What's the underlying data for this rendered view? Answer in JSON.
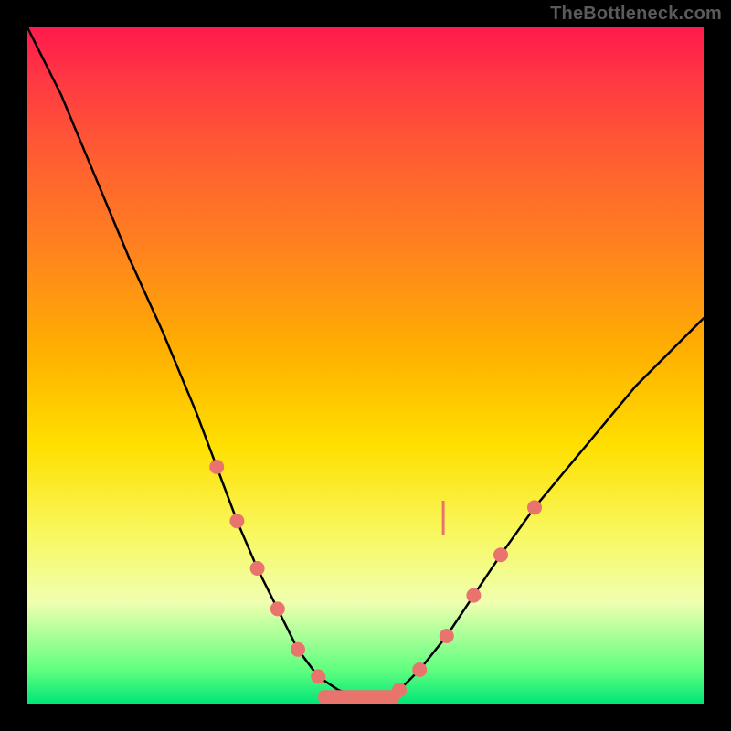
{
  "watermark": "TheBottleneck.com",
  "chart_data": {
    "type": "line",
    "title": "",
    "xlabel": "",
    "ylabel": "",
    "xlim": [
      0,
      100
    ],
    "ylim": [
      0,
      100
    ],
    "series": [
      {
        "name": "bottleneck-curve",
        "x": [
          0,
          5,
          10,
          15,
          20,
          25,
          28,
          31,
          34,
          37,
          40,
          43,
          46,
          49,
          52,
          55,
          58,
          62,
          66,
          70,
          75,
          80,
          85,
          90,
          95,
          100
        ],
        "y": [
          100,
          90,
          78,
          66,
          55,
          43,
          35,
          27,
          20,
          14,
          8,
          4,
          2,
          1,
          1,
          2,
          5,
          10,
          16,
          22,
          29,
          35,
          41,
          47,
          52,
          57
        ]
      }
    ],
    "markers": {
      "name": "highlight-dots",
      "color": "#e9746e",
      "points": [
        {
          "x": 28,
          "y": 35
        },
        {
          "x": 31,
          "y": 27
        },
        {
          "x": 34,
          "y": 20
        },
        {
          "x": 37,
          "y": 14
        },
        {
          "x": 40,
          "y": 8
        },
        {
          "x": 43,
          "y": 4
        },
        {
          "x": 55,
          "y": 2
        },
        {
          "x": 58,
          "y": 5
        },
        {
          "x": 62,
          "y": 10
        },
        {
          "x": 66,
          "y": 16
        },
        {
          "x": 70,
          "y": 22
        },
        {
          "x": 75,
          "y": 29
        }
      ]
    },
    "flat_band": {
      "name": "valley-band",
      "color": "#e9746e",
      "x0": 43,
      "x1": 55,
      "y": 1,
      "thickness_pct": 2
    },
    "annotation_tick": {
      "x": 61.5,
      "y0": 25,
      "y1": 30,
      "color": "#e9746e"
    }
  }
}
